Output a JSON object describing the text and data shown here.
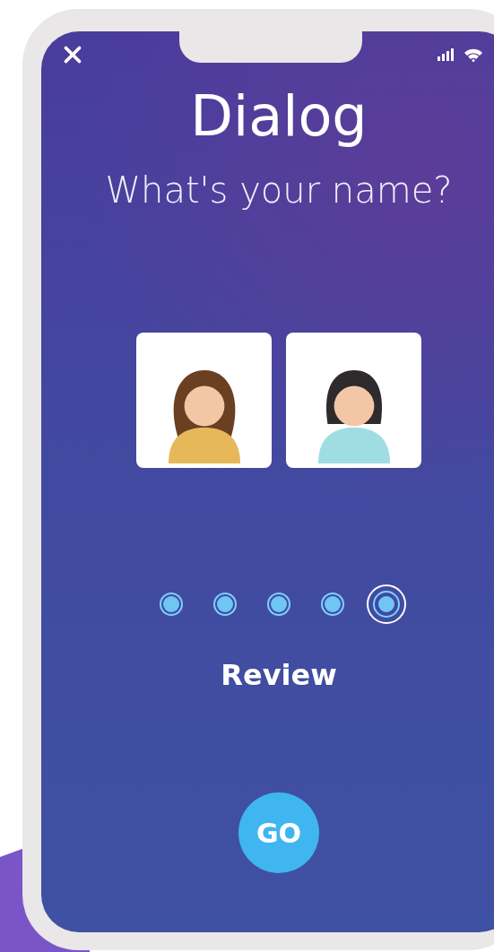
{
  "title": "Dialog",
  "question": "What's your name?",
  "avatars": [
    {
      "kind": "curly"
    },
    {
      "kind": "bob"
    }
  ],
  "steps": [
    {
      "selected": false
    },
    {
      "selected": false
    },
    {
      "selected": false
    },
    {
      "selected": false
    },
    {
      "selected": true
    }
  ],
  "step_label": "Review",
  "button": "GO"
}
